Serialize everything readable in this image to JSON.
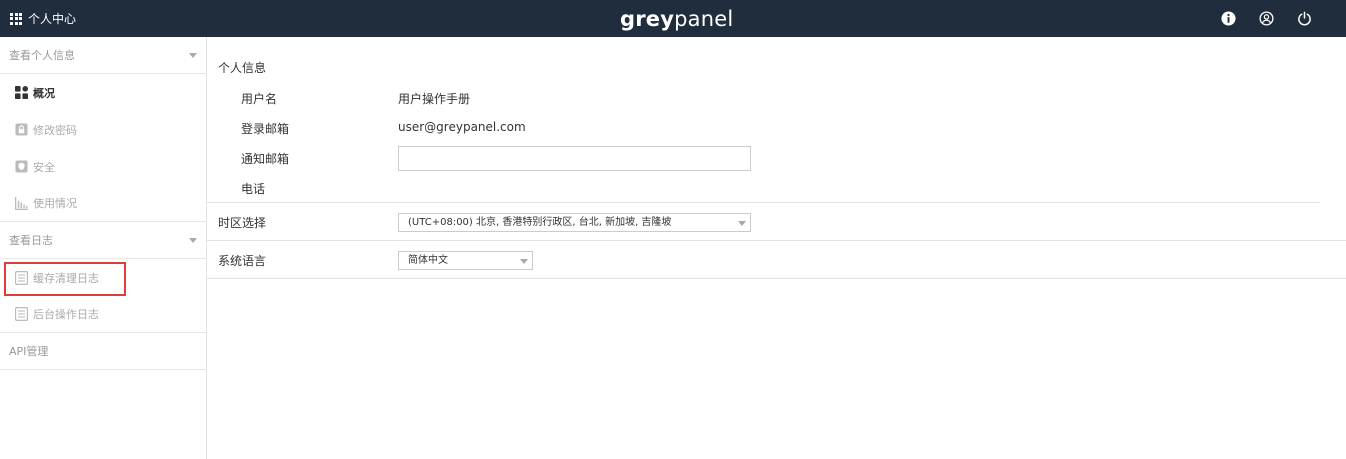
{
  "topbar": {
    "title": "个人中心",
    "logo_grey": "grey",
    "logo_panel": "panel",
    "icons": [
      "info-icon",
      "user-circle-icon",
      "power-icon"
    ]
  },
  "sidebar": {
    "sections": [
      {
        "header": "查看个人信息",
        "items": [
          {
            "label": "概况",
            "icon": "dashboard-icon",
            "active": true
          },
          {
            "label": "修改密码",
            "icon": "lock-icon"
          },
          {
            "label": "安全",
            "icon": "shield-icon"
          },
          {
            "label": "使用情况",
            "icon": "bar-chart-icon"
          }
        ]
      },
      {
        "header": "查看日志",
        "items": [
          {
            "label": "缓存清理日志",
            "icon": "log-icon",
            "highlighted": true
          },
          {
            "label": "后台操作日志",
            "icon": "log-icon"
          }
        ]
      },
      {
        "header": "API管理",
        "items": []
      }
    ]
  },
  "main": {
    "section_title": "个人信息",
    "fields": {
      "username_label": "用户名",
      "username_value": "用户操作手册",
      "login_email_label": "登录邮箱",
      "login_email_value": "user@greypanel.com",
      "notify_email_label": "通知邮箱",
      "notify_email_value": "",
      "phone_label": "电话"
    },
    "timezone": {
      "label": "时区选择",
      "value": "(UTC+08:00) 北京, 香港特别行政区, 台北, 新加坡, 吉隆坡"
    },
    "language": {
      "label": "系统语言",
      "value": "简体中文"
    }
  },
  "colors": {
    "topbar_bg": "#1f2d3d",
    "highlight_border": "#e03c3c"
  }
}
